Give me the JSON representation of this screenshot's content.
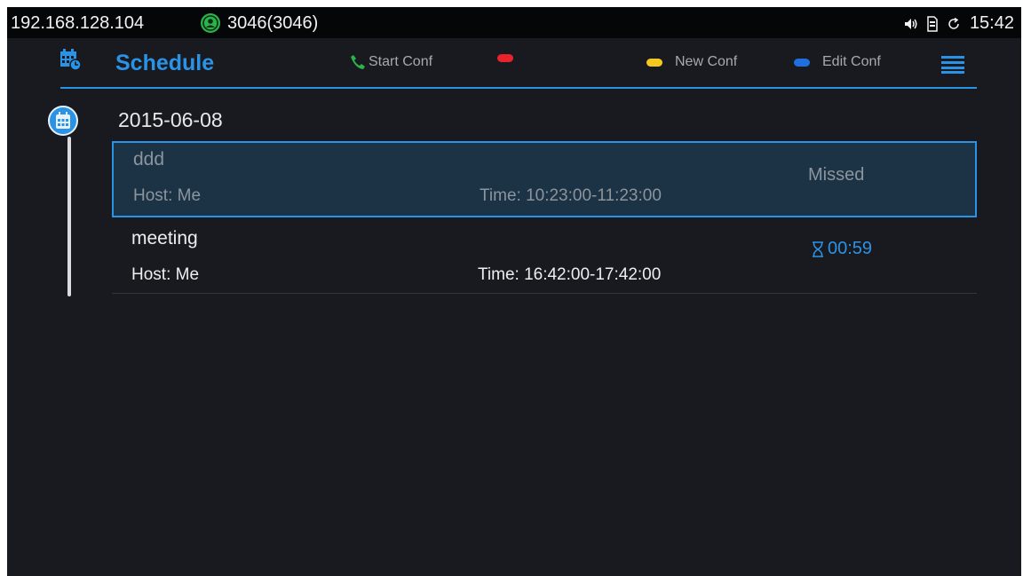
{
  "statusbar": {
    "ip": "192.168.128.104",
    "account": "3046(3046)",
    "clock": "15:42"
  },
  "header": {
    "title": "Schedule",
    "softkeys": [
      {
        "label": "Start Conf",
        "color": "#2bb34a",
        "icon": "phone-icon"
      },
      {
        "label": "",
        "color": "#e8232a"
      },
      {
        "label": "New Conf",
        "color": "#f4c81e"
      },
      {
        "label": "Edit Conf",
        "color": "#1f6fe0"
      }
    ]
  },
  "schedule": {
    "date": "2015-06-08",
    "meetings": [
      {
        "name": "ddd",
        "host": "Host: Me",
        "time": "Time: 10:23:00-11:23:00",
        "status": "Missed",
        "selected": true
      },
      {
        "name": "meeting",
        "host": "Host: Me",
        "time": "Time: 16:42:00-17:42:00",
        "status": "00:59",
        "status_icon": "hourglass-icon",
        "selected": false
      }
    ]
  },
  "colors": {
    "accent": "#2b93e6",
    "background": "#181a1f",
    "statusbar": "#050607",
    "selected_row": "#1c3346"
  }
}
